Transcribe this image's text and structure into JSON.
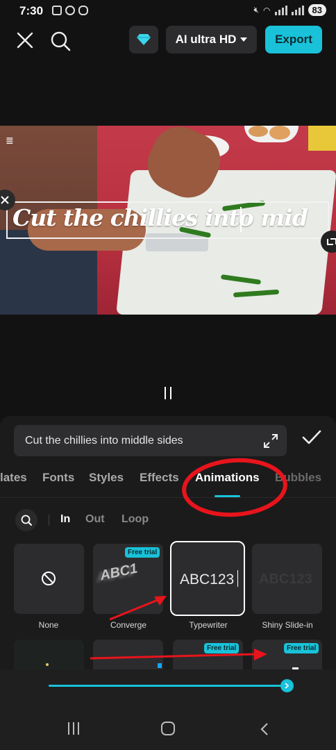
{
  "status_bar": {
    "time": "7:30",
    "battery": "83"
  },
  "toolbar": {
    "quality_label": "AI ultra HD",
    "export_label": "Export"
  },
  "preview": {
    "caption": "Cut the chillies into mid"
  },
  "editor": {
    "text_value": "Cut the chillies into middle sides"
  },
  "tabs": [
    {
      "label": "lates"
    },
    {
      "label": "Fonts"
    },
    {
      "label": "Styles"
    },
    {
      "label": "Effects"
    },
    {
      "label": "Animations",
      "active": true
    },
    {
      "label": "Bubbles"
    }
  ],
  "sub_tabs": [
    {
      "label": "In",
      "active": true
    },
    {
      "label": "Out"
    },
    {
      "label": "Loop"
    }
  ],
  "animations": [
    {
      "label": "None"
    },
    {
      "label": "Converge",
      "badge": "Free trial",
      "sample": "ABC1"
    },
    {
      "label": "Typewriter",
      "sample": "ABC123",
      "selected": true
    },
    {
      "label": "Shiny Slide-in",
      "sample": "ABC123"
    },
    {
      "label": "",
      "badge": ""
    },
    {
      "label": ""
    },
    {
      "label": "",
      "badge": "Free trial"
    },
    {
      "label": "",
      "badge": "Free trial"
    }
  ],
  "slider": {
    "value": 1.0
  },
  "colors": {
    "accent": "#19c2d9",
    "annotation": "#e8141c",
    "background": "#121212",
    "panel": "#1b1b1b"
  }
}
